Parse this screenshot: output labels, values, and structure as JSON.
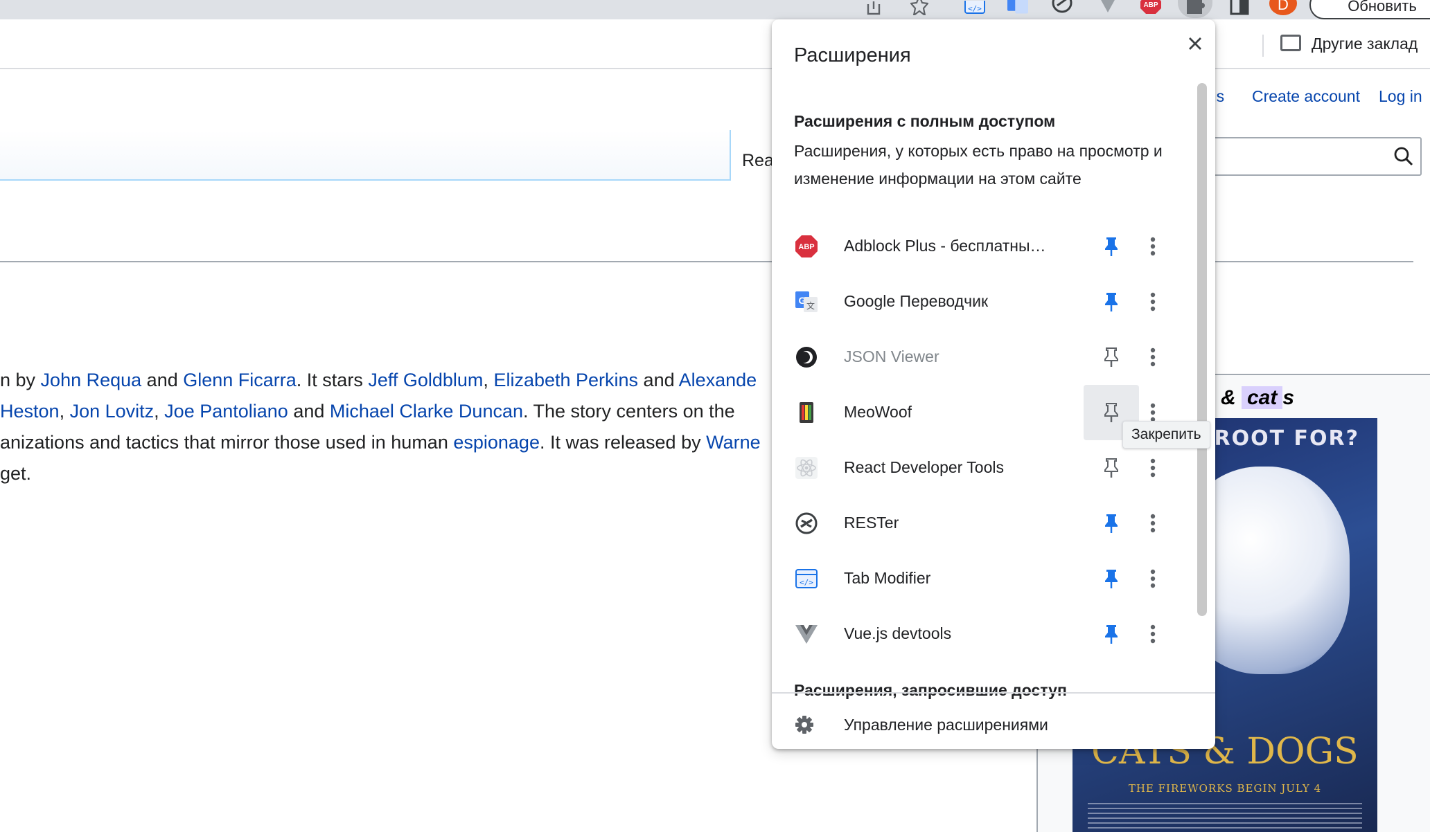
{
  "browser": {
    "update_button": "Обновить",
    "avatar_letter": "D",
    "bookmark_folder": "Другие заклад"
  },
  "wiki": {
    "header_links": [
      "ons",
      "Create account",
      "Log in"
    ],
    "read_tab": "Rea",
    "lines": [
      [
        [
          "t",
          "n by "
        ],
        [
          "l",
          "John Requa"
        ],
        [
          "t",
          " and "
        ],
        [
          "l",
          "Glenn Ficarra"
        ],
        [
          "t",
          ". It stars "
        ],
        [
          "l",
          "Jeff Goldblum"
        ],
        [
          "t",
          ", "
        ],
        [
          "l",
          "Elizabeth Perkins"
        ],
        [
          "t",
          " and "
        ],
        [
          "l",
          "Alexande"
        ]
      ],
      [
        [
          "l",
          " Heston"
        ],
        [
          "t",
          ", "
        ],
        [
          "l",
          "Jon Lovitz"
        ],
        [
          "t",
          ", "
        ],
        [
          "l",
          "Joe Pantoliano"
        ],
        [
          "t",
          " and "
        ],
        [
          "l",
          "Michael Clarke Duncan"
        ],
        [
          "t",
          ". The story centers on the"
        ]
      ],
      [
        [
          "t",
          "anizations and tactics that mirror those used in human "
        ],
        [
          "l",
          "espionage"
        ],
        [
          "t",
          ". It was released by "
        ],
        [
          "l",
          "Warne"
        ]
      ],
      [
        [
          "t",
          "get."
        ]
      ]
    ],
    "infobox_title_prefix": "& ",
    "infobox_title_highlight": "cat",
    "infobox_title_suffix": "s",
    "poster": {
      "top_text": "DU ROOT FOR?",
      "logo": "CATS & DOGS",
      "tagline": "THE FIREWORKS BEGIN JULY 4"
    }
  },
  "extensions_popup": {
    "title": "Расширения",
    "full_access_heading": "Расширения с полным доступом",
    "full_access_description": "Расширения, у которых есть право на просмотр и изменение информации на этом сайте",
    "items": [
      {
        "name": "Adblock Plus - бесплатны…",
        "icon": "abp-icon",
        "pinned": true,
        "dimmed": false
      },
      {
        "name": "Google Переводчик",
        "icon": "google-translate-icon",
        "pinned": true,
        "dimmed": false
      },
      {
        "name": "JSON Viewer",
        "icon": "json-viewer-icon",
        "pinned": false,
        "dimmed": true
      },
      {
        "name": "MeoWoof",
        "icon": "meowoof-icon",
        "pinned": false,
        "dimmed": false,
        "hovered": true
      },
      {
        "name": "React Developer Tools",
        "icon": "react-icon",
        "pinned": false,
        "dimmed": false
      },
      {
        "name": "RESTer",
        "icon": "rester-icon",
        "pinned": true,
        "dimmed": false
      },
      {
        "name": "Tab Modifier",
        "icon": "tab-modifier-icon",
        "pinned": true,
        "dimmed": false
      },
      {
        "name": "Vue.js devtools",
        "icon": "vue-icon",
        "pinned": true,
        "dimmed": false
      }
    ],
    "requested_access_heading": "Расширения, запросившие доступ",
    "manage_label": "Управление расширениями",
    "tooltip": "Закрепить"
  },
  "colors": {
    "link": "#0645ad",
    "pin_active": "#1a73e8",
    "pin_inactive": "#5f6368"
  }
}
